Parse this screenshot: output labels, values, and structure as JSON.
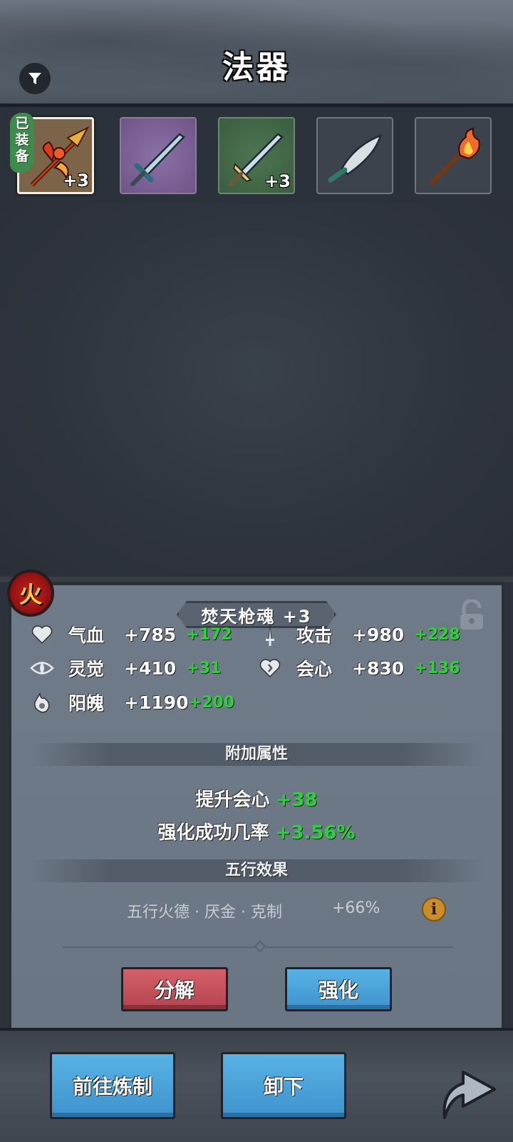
{
  "header": {
    "title": "法器",
    "filter_icon": "filter-icon"
  },
  "equipment": {
    "equipped_tag": "已装备",
    "slots": [
      {
        "name": "fire-spear",
        "plus": "+3",
        "equipped": true,
        "color": "#7b6447"
      },
      {
        "name": "purple-sword",
        "plus": "",
        "equipped": false,
        "color": "#8b72a6"
      },
      {
        "name": "green-sword",
        "plus": "+3",
        "equipped": false,
        "color": "#4c7552"
      },
      {
        "name": "curved-blade",
        "plus": "",
        "equipped": false,
        "color": "#3c434d"
      },
      {
        "name": "fire-torch",
        "plus": "",
        "equipped": false,
        "color": "#3c434d"
      }
    ]
  },
  "detail": {
    "element": "火",
    "item_name": "焚天枪魂 +3",
    "stats": [
      {
        "icon": "heart-icon",
        "label": "气血",
        "value": "+785",
        "bonus": "+172"
      },
      {
        "icon": "sword-icon",
        "label": "攻击",
        "value": "+980",
        "bonus": "+228"
      },
      {
        "icon": "eye-icon",
        "label": "灵觉",
        "value": "+410",
        "bonus": "+31"
      },
      {
        "icon": "crit-heart-icon",
        "label": "会心",
        "value": "+830",
        "bonus": "+136"
      },
      {
        "icon": "flame-soul-icon",
        "label": "阳魄",
        "value": "+1190",
        "bonus": "+200"
      }
    ],
    "extra_section_title": "附加属性",
    "extra": [
      {
        "label": "提升会心",
        "value": "+38"
      },
      {
        "label": "强化成功几率",
        "value": "+3.56%"
      }
    ],
    "wuxing_section_title": "五行效果",
    "wuxing_text": "五行火德 · 厌金 · 克制",
    "wuxing_value": "+66%",
    "buttons": {
      "decompose": "分解",
      "enhance": "强化"
    }
  },
  "footer": {
    "craft": "前往炼制",
    "unequip": "卸下"
  }
}
